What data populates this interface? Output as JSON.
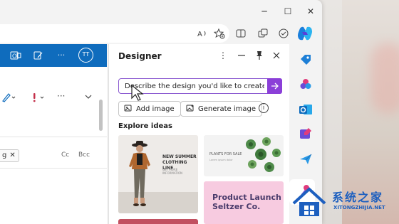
{
  "browser": {
    "window_controls": {
      "minimize": "─",
      "maximize": "☐",
      "close": "✕"
    },
    "toolbar_icons": [
      "read-aloud-icon",
      "favorite-add-icon",
      "split-screen-icon",
      "extensions-icon",
      "collections-icon",
      "copilot-icon"
    ]
  },
  "outlook": {
    "avatar_initials": "TT",
    "more": "···",
    "recipient_chip": "g",
    "cc_label": "Cc",
    "bcc_label": "Bcc",
    "accent": "#0f6cbd"
  },
  "designer": {
    "title": "Designer",
    "more": "⋮",
    "prompt_placeholder": "Describe the design you'd like to create",
    "add_image_label": "Add image",
    "generate_image_label": "Generate image",
    "info": "i",
    "explore_label": "Explore ideas",
    "accent": "#8b3fd8",
    "ideas": [
      {
        "title": "NEW SUMMER\nCLOTHING LINE",
        "subtitle": "GET MORE INFORMATION"
      },
      {
        "title": "PLANTS FOR SALE",
        "subtitle": "Lorem ipsum dolor"
      },
      {
        "title": "Product Launch\nSeltzer Co."
      }
    ]
  },
  "watermark": {
    "text": "系统之家",
    "subtext": "XITONGZHIJIA.NET"
  }
}
